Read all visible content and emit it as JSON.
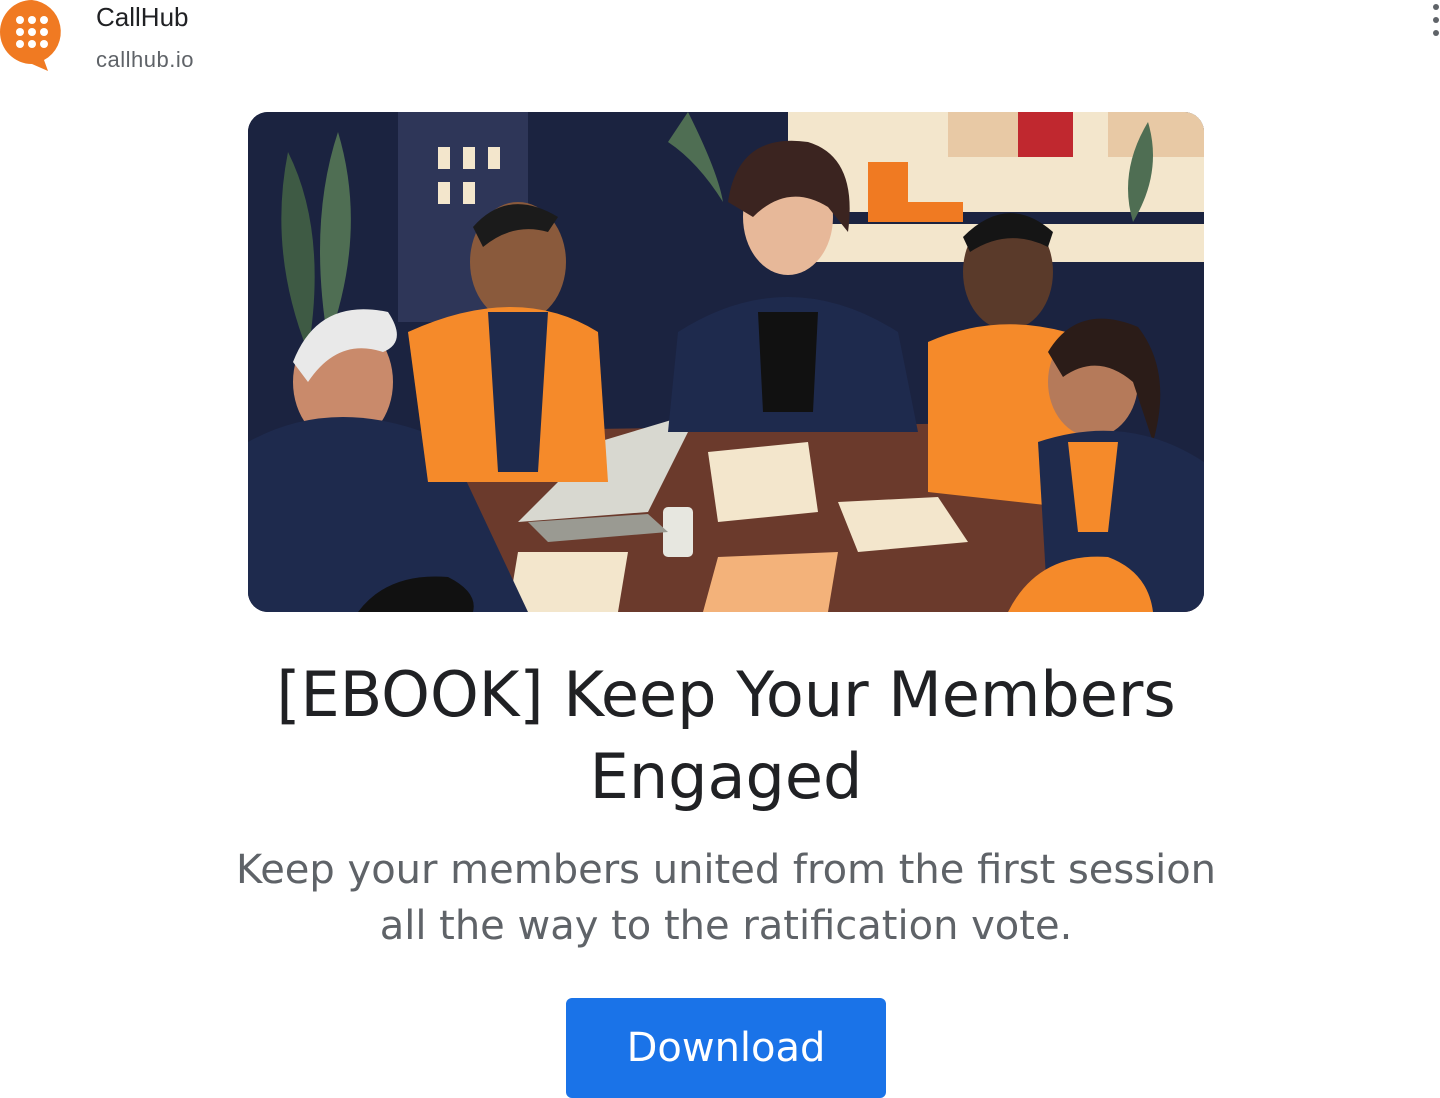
{
  "advertiser": {
    "name": "CallHub",
    "domain": "callhub.io"
  },
  "menu": {
    "icon": "more-vert-icon"
  },
  "hero": {
    "icon": "meeting-illustration"
  },
  "ad": {
    "title": "[EBOOK] Keep Your Members Engaged",
    "description": "Keep your members united from the first session all the way to the ratification vote.",
    "cta_label": "Download"
  },
  "colors": {
    "brand_orange": "#f07a22",
    "cta_blue": "#1a73e8",
    "illustration_navy": "#1b2340"
  }
}
